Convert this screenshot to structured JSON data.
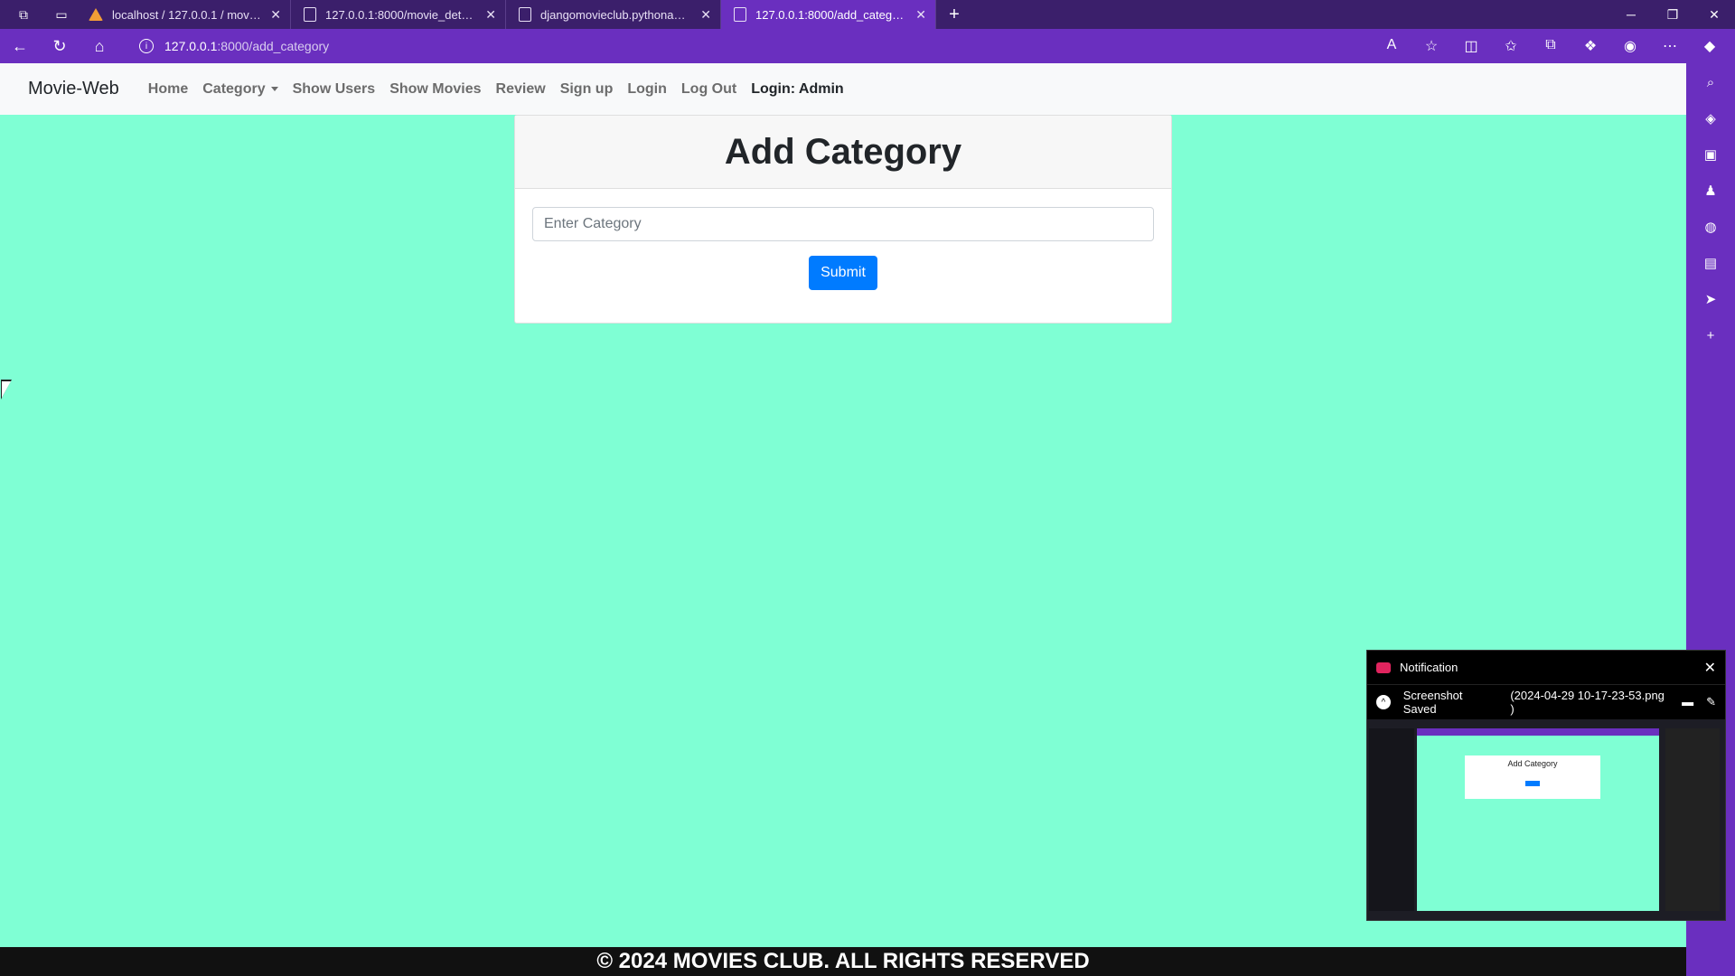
{
  "browser": {
    "tabs": [
      {
        "label": "localhost / 127.0.0.1 / movies_db"
      },
      {
        "label": "127.0.0.1:8000/movie_details/"
      },
      {
        "label": "djangomovieclub.pythonanywhere"
      },
      {
        "label": "127.0.0.1:8000/add_category"
      }
    ],
    "url_host": "127.0.0.1",
    "url_path": ":8000/add_category"
  },
  "navbar": {
    "brand": "Movie-Web",
    "links": {
      "home": "Home",
      "category": "Category",
      "show_users": "Show Users",
      "show_movies": "Show Movies",
      "review": "Review",
      "sign_up": "Sign up",
      "login": "Login",
      "log_out": "Log Out",
      "user": "Login: Admin"
    }
  },
  "form": {
    "title": "Add Category",
    "input_placeholder": "Enter Category",
    "submit_label": "Submit"
  },
  "footer": {
    "text": "© 2024 MOVIES CLUB. ALL RIGHTS RESERVED"
  },
  "notification": {
    "title": "Notification",
    "status": "Screenshot Saved",
    "filename": "(2024-04-29 10-17-23-53.png )",
    "preview_title": "Add Category"
  },
  "colors": {
    "page_bg": "#7fffd4",
    "browser_accent": "#6a2fbf",
    "button": "#007bff"
  }
}
